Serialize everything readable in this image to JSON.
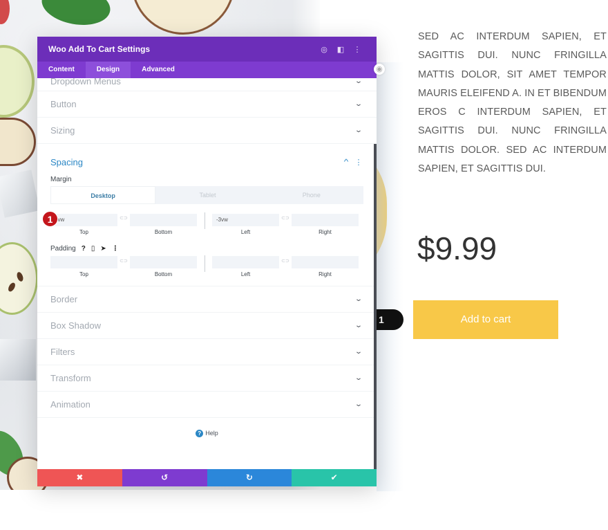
{
  "modal": {
    "title": "Woo Add To Cart Settings",
    "header_icons": [
      "focus-icon",
      "split-view-icon",
      "more-options-icon"
    ],
    "tabs": [
      {
        "label": "Content",
        "active": false
      },
      {
        "label": "Design",
        "active": true
      },
      {
        "label": "Advanced",
        "active": false
      }
    ],
    "toggles_above": [
      {
        "label": "Dropdown Menus"
      },
      {
        "label": "Button"
      },
      {
        "label": "Sizing"
      }
    ],
    "spacing": {
      "title": "Spacing",
      "margin_label": "Margin",
      "devices": [
        "Desktop",
        "Tablet",
        "Phone"
      ],
      "active_device": "Desktop",
      "margin": {
        "top": "2vw",
        "bottom": "",
        "left": "-3vw",
        "right": "",
        "captions": {
          "top": "Top",
          "bottom": "Bottom",
          "left": "Left",
          "right": "Right"
        }
      },
      "padding_label": "Padding",
      "padding_icons": [
        "help-icon",
        "responsive-icon",
        "hover-icon",
        "more-icon"
      ],
      "padding": {
        "top": "",
        "bottom": "",
        "left": "",
        "right": "",
        "captions": {
          "top": "Top",
          "bottom": "Bottom",
          "left": "Left",
          "right": "Right"
        }
      },
      "annotation_badge": "1"
    },
    "toggles_below": [
      {
        "label": "Border"
      },
      {
        "label": "Box Shadow"
      },
      {
        "label": "Filters"
      },
      {
        "label": "Transform"
      },
      {
        "label": "Animation"
      }
    ],
    "help_label": "Help",
    "footer": {
      "cancel": "✖",
      "undo": "↺",
      "redo": "↻",
      "save": "✔"
    },
    "colors": {
      "header": "#6c2eb9",
      "tabs": "#7e3bd0",
      "accent": "#2b87c5",
      "cancel": "#ef5555",
      "undo": "#7e3bd0",
      "redo": "#2b87da",
      "save": "#29c4a9"
    }
  },
  "product": {
    "description": "SED AC INTERDUM SAPIEN, ET SAGITTIS DUI. NUNC FRINGILLA MATTIS DOLOR, SIT AMET TEMPOR MAURIS ELEIFEND A. IN ET BIBENDUM EROS C INTERDUM SAPIEN, ET SAGITTIS DUI. NUNC FRINGILLA MATTIS DOLOR. SED AC INTERDUM SAPIEN, ET SAGITTIS DUI.",
    "price": "$9.99",
    "quantity": "1",
    "add_to_cart_label": "Add to cart",
    "button_color": "#f8c848"
  }
}
